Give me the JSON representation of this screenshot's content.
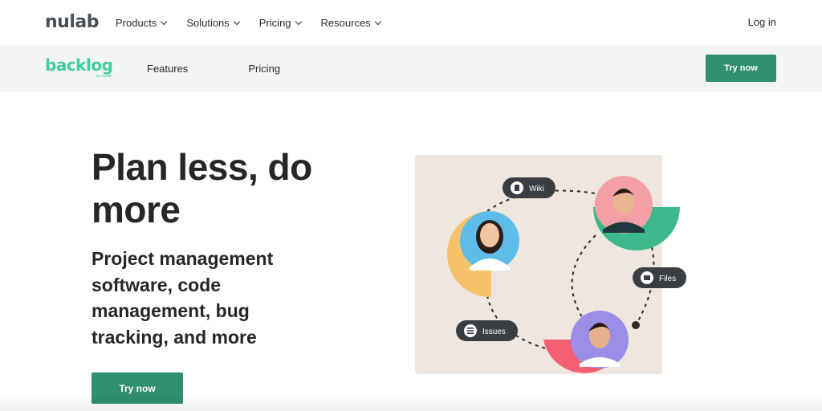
{
  "topbar": {
    "logo": "nulab",
    "nav": [
      {
        "label": "Products"
      },
      {
        "label": "Solutions"
      },
      {
        "label": "Pricing"
      },
      {
        "label": "Resources"
      }
    ],
    "login": "Log in"
  },
  "productbar": {
    "logo": "backlog",
    "logo_sub": "by nulab",
    "nav": [
      {
        "label": "Features"
      },
      {
        "label": "Pricing"
      }
    ],
    "cta": "Try now"
  },
  "hero": {
    "title": "Plan less, do more",
    "subtitle": "Project management software, code management, bug tracking, and more",
    "cta": "Try now"
  },
  "illustration": {
    "pills": [
      {
        "label": "Wiki",
        "icon": "wiki-icon"
      },
      {
        "label": "Files",
        "icon": "folder-icon"
      },
      {
        "label": "Issues",
        "icon": "list-icon"
      }
    ],
    "colors": {
      "panel": "#efe6df",
      "yellow": "#f6c36a",
      "green": "#3bb98c",
      "red": "#f45f73",
      "pill": "#3a3d42"
    }
  },
  "colors": {
    "brand_green": "#42ce9f",
    "button_green": "#2f8f6f",
    "productbar_bg": "#f3f4f5"
  }
}
